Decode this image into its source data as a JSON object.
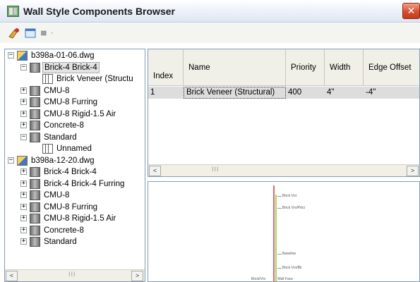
{
  "window": {
    "title": "Wall Style Components Browser",
    "close_glyph": "✕"
  },
  "toolbar": {
    "buttons": [
      {
        "name": "add-component-icon"
      },
      {
        "name": "copy-icon"
      },
      {
        "name": "display-dropdown-icon"
      }
    ]
  },
  "tree": {
    "rows": [
      {
        "label": "b398a-01-06.dwg",
        "icon": "dwg-file-icon",
        "expander": "−"
      },
      {
        "label": "Brick-4 Brick-4",
        "icon": "wall-style-icon",
        "expander": "−"
      },
      {
        "label": "Brick Veneer (Structu",
        "icon": "component-icon",
        "expander": ""
      },
      {
        "label": "CMU-8",
        "icon": "wall-style-icon",
        "expander": "+"
      },
      {
        "label": "CMU-8 Furring",
        "icon": "wall-style-icon",
        "expander": "+"
      },
      {
        "label": "CMU-8 Rigid-1.5 Air",
        "icon": "wall-style-icon",
        "expander": "+"
      },
      {
        "label": "Concrete-8",
        "icon": "wall-style-icon",
        "expander": "+"
      },
      {
        "label": "Standard",
        "icon": "wall-style-icon",
        "expander": "−"
      },
      {
        "label": "Unnamed",
        "icon": "component-icon",
        "expander": ""
      },
      {
        "label": "b398a-12-20.dwg",
        "icon": "dwg-file-icon",
        "expander": "−"
      },
      {
        "label": "Brick-4 Brick-4",
        "icon": "wall-style-icon",
        "expander": "+"
      },
      {
        "label": "Brick-4 Brick-4 Furring",
        "icon": "wall-style-icon",
        "expander": "+"
      },
      {
        "label": "CMU-8",
        "icon": "wall-style-icon",
        "expander": "+"
      },
      {
        "label": "CMU-8 Furring",
        "icon": "wall-style-icon",
        "expander": "+"
      },
      {
        "label": "CMU-8 Rigid-1.5 Air",
        "icon": "wall-style-icon",
        "expander": "+"
      },
      {
        "label": "Concrete-8",
        "icon": "wall-style-icon",
        "expander": "+"
      },
      {
        "label": "Standard",
        "icon": "wall-style-icon",
        "expander": "+"
      }
    ],
    "scroll_left": "<",
    "scroll_right": ">",
    "scroll_grip": "III"
  },
  "grid": {
    "columns": [
      "Index",
      "Name",
      "Priority",
      "Width",
      "Edge Offset"
    ],
    "rows": [
      {
        "index": "1",
        "name": "Brick Veneer (Structural)",
        "priority": "400",
        "width": "4\"",
        "edge_offset": "-4\""
      }
    ],
    "scroll_left": "<",
    "scroll_right": ">",
    "scroll_grip": "III"
  },
  "preview": {
    "labels": [
      "Brick Vnr",
      "Brick Vnr/Prtct",
      "Baseline",
      "Brick Vnr/Bk",
      "Brick/Vnr",
      "Wall Face"
    ]
  },
  "colors": {
    "preview_red_line": "#e0303a",
    "preview_green_line": "#7ccb2a",
    "selection_row": "#dddddd"
  }
}
